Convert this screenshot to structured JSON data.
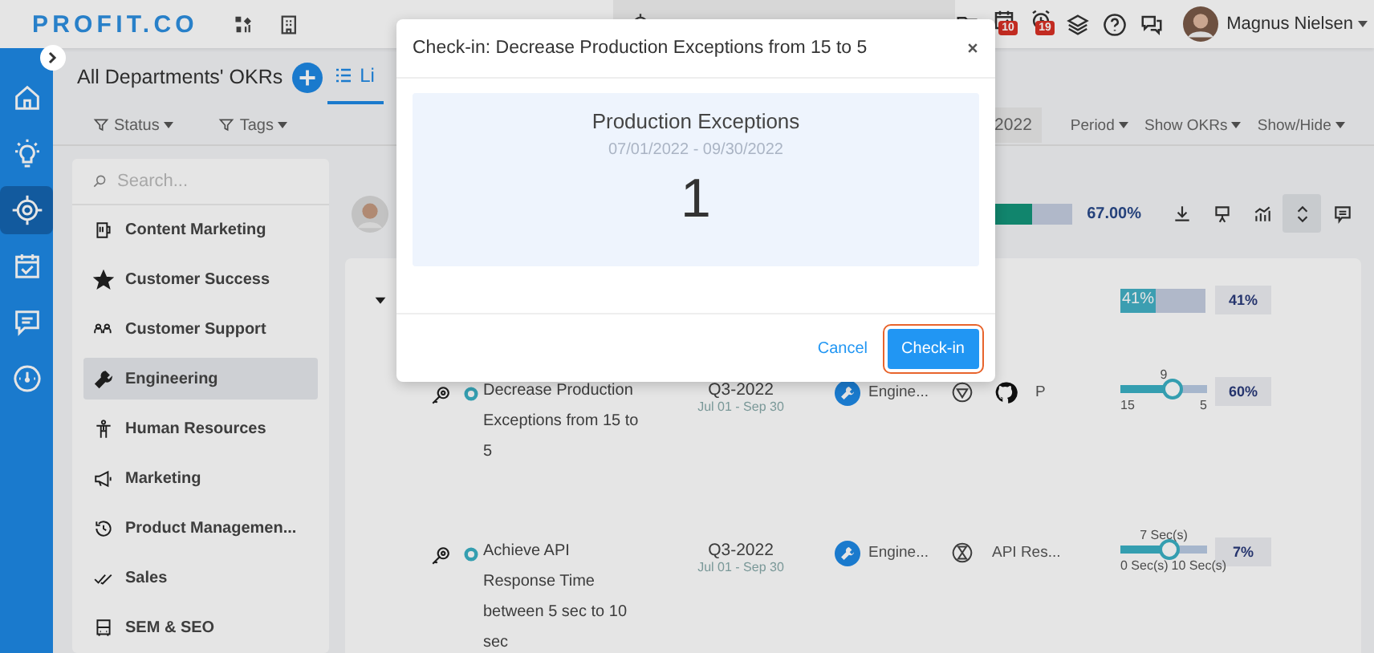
{
  "topbar": {
    "logo": "PROFIT.CO",
    "badges": [
      "10",
      "19"
    ],
    "user": {
      "name": "Magnus Nielsen"
    }
  },
  "rail": [
    {
      "kind": "home",
      "selected": false
    },
    {
      "kind": "bulb",
      "selected": false
    },
    {
      "kind": "target",
      "selected": true
    },
    {
      "kind": "calendar",
      "selected": false
    },
    {
      "kind": "chat",
      "selected": false
    },
    {
      "kind": "gauge",
      "selected": false
    }
  ],
  "header": {
    "title": "All Departments' OKRs",
    "view_tab": {
      "label": "Li",
      "selected": true
    }
  },
  "filters": [
    "Status",
    "Tags"
  ],
  "period_field": {
    "value": "2022"
  },
  "menus": [
    "Period",
    "Show OKRs",
    "Show/Hide"
  ],
  "departments": {
    "search": {
      "placeholder": "Search..."
    },
    "items": [
      {
        "label": "Content Marketing",
        "kind": "mug",
        "selected": false
      },
      {
        "label": "Customer Success",
        "kind": "star",
        "selected": false
      },
      {
        "label": "Customer Support",
        "kind": "people",
        "selected": false
      },
      {
        "label": "Engineering",
        "kind": "wrench",
        "selected": true
      },
      {
        "label": "Human Resources",
        "kind": "person",
        "selected": false
      },
      {
        "label": "Marketing",
        "kind": "megaphone",
        "selected": false
      },
      {
        "label": "Product Managemen...",
        "kind": "history",
        "selected": false
      },
      {
        "label": "Sales",
        "kind": "checks",
        "selected": false
      },
      {
        "label": "SEM & SEO",
        "kind": "bus",
        "selected": false
      }
    ]
  },
  "summary": {
    "level": 0.67,
    "reading": "67.00%"
  },
  "toolbar": [
    {
      "kind": "download",
      "selected": false
    },
    {
      "kind": "present",
      "selected": false
    },
    {
      "kind": "chart",
      "selected": false
    },
    {
      "kind": "expand",
      "selected": true
    },
    {
      "kind": "comment",
      "selected": false
    }
  ],
  "objective": {
    "level": 0.41,
    "bar_label": "41%",
    "reading": "41%"
  },
  "key_results": [
    {
      "title": "Decrease Production Exceptions from 15 to 5",
      "quarter": "Q3-2022",
      "range": "Jul 01 - Sep 30",
      "department": "Engine...",
      "extras": [
        {
          "kind": "triangle"
        },
        {
          "kind": "github"
        }
      ],
      "extra_text": "P",
      "slider": {
        "current": "9",
        "start": "15",
        "end": "5",
        "level": 0.6
      },
      "reading": "60%"
    },
    {
      "title": "Achieve API Response Time between 5 sec to 10 sec",
      "quarter": "Q3-2022",
      "range": "Jul 01 - Sep 30",
      "department": "Engine...",
      "extras": [
        {
          "kind": "hourglass"
        }
      ],
      "extra_text": "API Res...",
      "slider": {
        "current": "7 Sec(s)",
        "start": "0 Sec(s)",
        "end": "10 Sec(s)",
        "level": 0.55
      },
      "reading": "7%"
    }
  ],
  "modal": {
    "title": "Check-in: Decrease Production Exceptions from 15 to 5",
    "metric": "Production Exceptions",
    "period": "07/01/2022 - 09/30/2022",
    "value": "1",
    "cancel": "Cancel",
    "confirm": "Check-in"
  }
}
